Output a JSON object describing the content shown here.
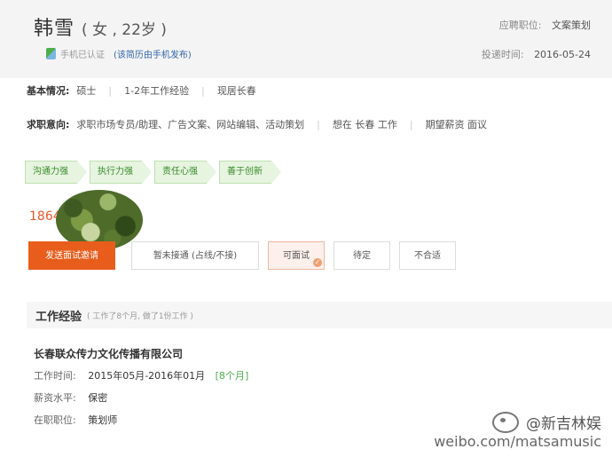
{
  "profile": {
    "name": "韩雪",
    "gender_age": "( 女 , 22岁 )",
    "verify_text": "手机已认证",
    "source_text": "(该简历由手机发布)",
    "apply_label": "应聘职位:",
    "apply_value": "文案策划",
    "date_label": "投递时间:",
    "date_value": "2016-05-24"
  },
  "basic": {
    "label": "基本情况:",
    "items": [
      "硕士",
      "1-2年工作经验",
      "现居长春"
    ]
  },
  "intent": {
    "label": "求职意向:",
    "items": [
      "求职市场专员/助理、广告文案、网站编辑、活动策划",
      "想在 长春 工作",
      "期望薪资 面议"
    ]
  },
  "tags": [
    "沟通力强",
    "执行力强",
    "责任心强",
    "善于创新"
  ],
  "phone": "1864",
  "buttons": {
    "invite": "发送面试邀请",
    "no_answer": "暂未接通 (占线/不接)",
    "can_interview": "可面试",
    "pending": "待定",
    "unsuitable": "不合适"
  },
  "work": {
    "title": "工作经验",
    "subtitle": "( 工作了8个月, 做了1份工作 )",
    "company": "长春联众传力文化传播有限公司",
    "time_label": "工作时间:",
    "time_value": "2015年05月-2016年01月",
    "duration": "[8个月]",
    "salary_label": "薪资水平:",
    "salary_value": "保密",
    "position_label": "在职职位:",
    "position_value": "策划师"
  },
  "watermark": {
    "handle": "@新吉林娱",
    "url": "weibo.com/matsamusic"
  },
  "colors": {
    "accent": "#e85d1c",
    "tag_green": "#3a8a2a",
    "link_blue": "#3366aa"
  },
  "icons": {
    "phone_verified": "phone-verified-icon",
    "check": "check-icon",
    "weibo": "weibo-logo"
  }
}
